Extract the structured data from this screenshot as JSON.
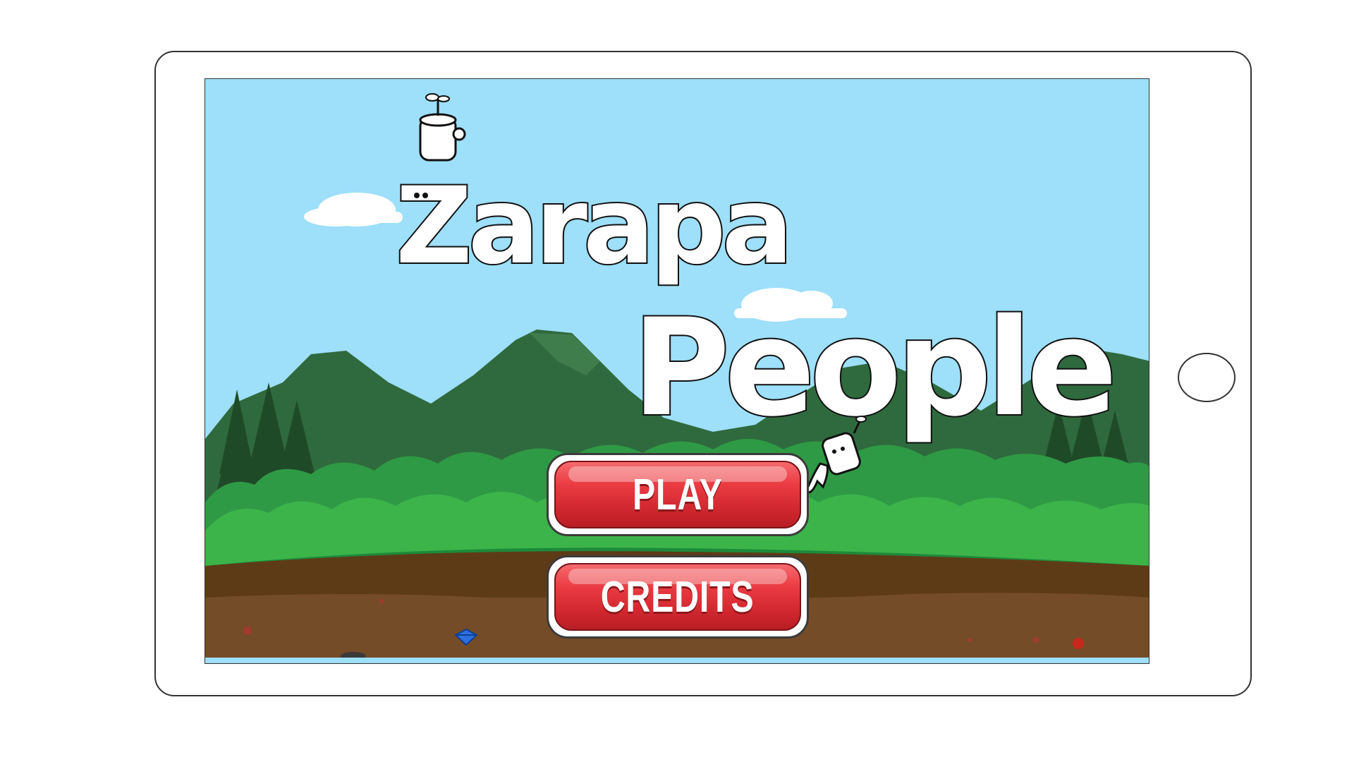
{
  "game": {
    "title_line1": "Zarapa",
    "title_line2": "People"
  },
  "menu": {
    "play_label": "PLAY",
    "credits_label": "CREDITS"
  },
  "colors": {
    "sky": "#9edff9",
    "mountain": "#2f6a3e",
    "bushes": "#3cb44a",
    "ground": "#6b4a25",
    "button_red": "#e2323a"
  }
}
